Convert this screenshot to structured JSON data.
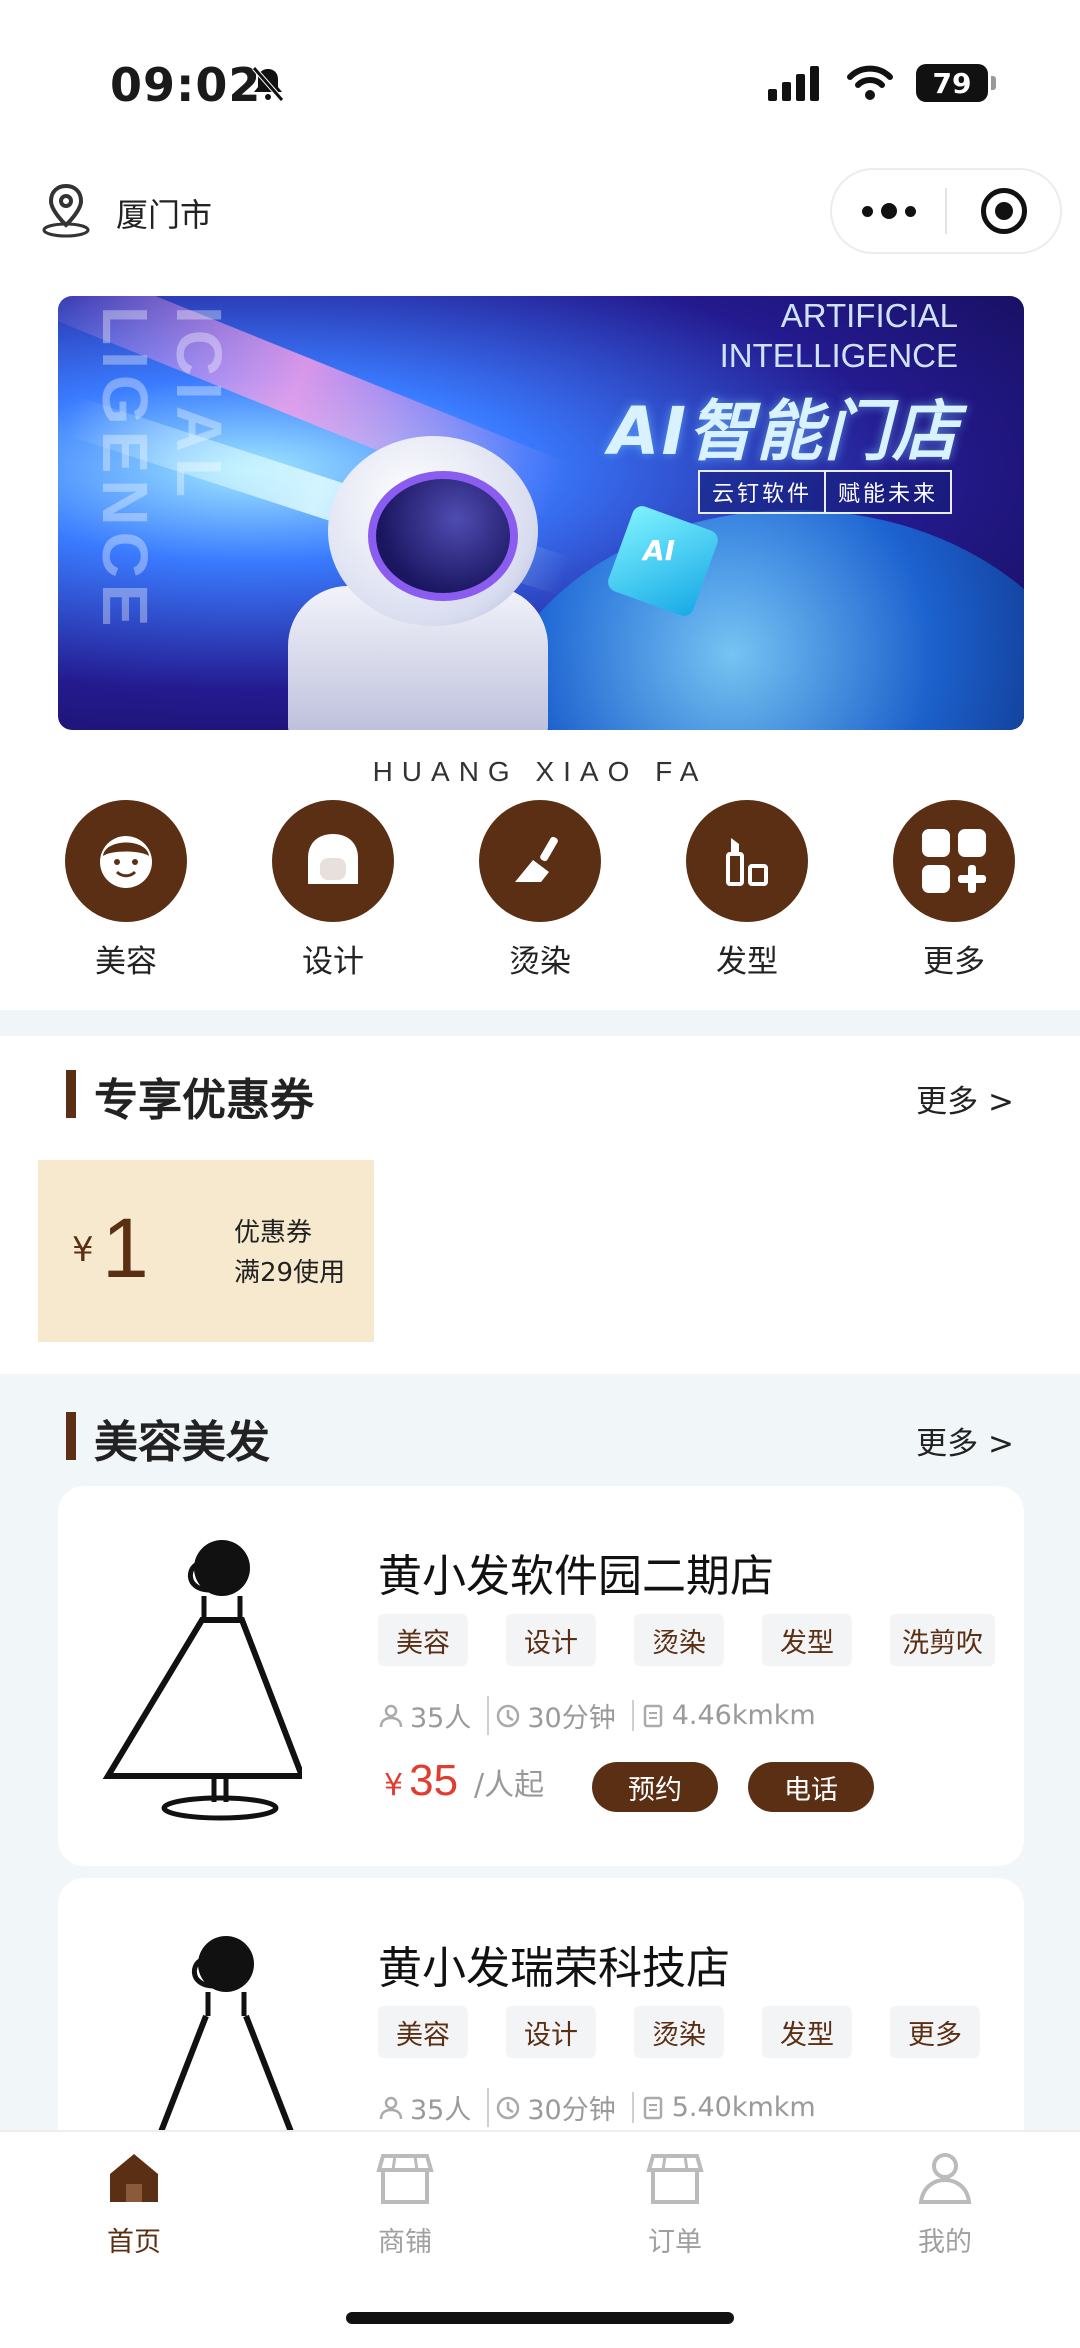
{
  "status_bar": {
    "time": "09:02",
    "battery": "79"
  },
  "nav": {
    "city": "厦门市"
  },
  "banner": {
    "en_line1": "ARTIFICIAL",
    "en_line2": "INTELLIGENCE",
    "title": "AI智能门店",
    "sub_left": "云钉软件",
    "sub_right": "赋能未来",
    "side_text": "ICIAL LIGENCE",
    "cube_text": "AI"
  },
  "brand": "HUANG XIAO FA",
  "categories": [
    {
      "label": "美容",
      "icon": "face-icon"
    },
    {
      "label": "设计",
      "icon": "hair-icon"
    },
    {
      "label": "烫染",
      "icon": "brush-icon"
    },
    {
      "label": "发型",
      "icon": "lipstick-icon"
    },
    {
      "label": "更多",
      "icon": "grid-plus-icon"
    }
  ],
  "coupons_section": {
    "title": "专享优惠券",
    "more": "更多 >",
    "coupon": {
      "symbol": "¥",
      "amount": "1",
      "line1": "优惠券",
      "line2": "满29使用"
    }
  },
  "stores_section": {
    "title": "美容美发",
    "more": "更多 >",
    "stores": [
      {
        "name": "黄小发软件园二期店",
        "tags": [
          "美容",
          "设计",
          "烫染",
          "发型",
          "洗剪吹"
        ],
        "people": "35人",
        "duration": "30分钟",
        "distance": "4.46kmkm",
        "price_symbol": "¥",
        "price": "35",
        "price_unit": "/人起",
        "book_label": "预约",
        "call_label": "电话"
      },
      {
        "name": "黄小发瑞荣科技店",
        "tags": [
          "美容",
          "设计",
          "烫染",
          "发型",
          "更多"
        ],
        "people": "35人",
        "duration": "30分钟",
        "distance": "5.40kmkm"
      }
    ]
  },
  "tabbar": [
    {
      "label": "首页",
      "icon": "home-icon",
      "active": true
    },
    {
      "label": "商铺",
      "icon": "shop-icon",
      "active": false
    },
    {
      "label": "订单",
      "icon": "order-icon",
      "active": false
    },
    {
      "label": "我的",
      "icon": "user-icon",
      "active": false
    }
  ],
  "colors": {
    "brand_brown": "#5b2f14",
    "price_red": "#e23b2f",
    "coupon_bg": "#f7e9cd",
    "section_bg": "#f1f7f9"
  }
}
